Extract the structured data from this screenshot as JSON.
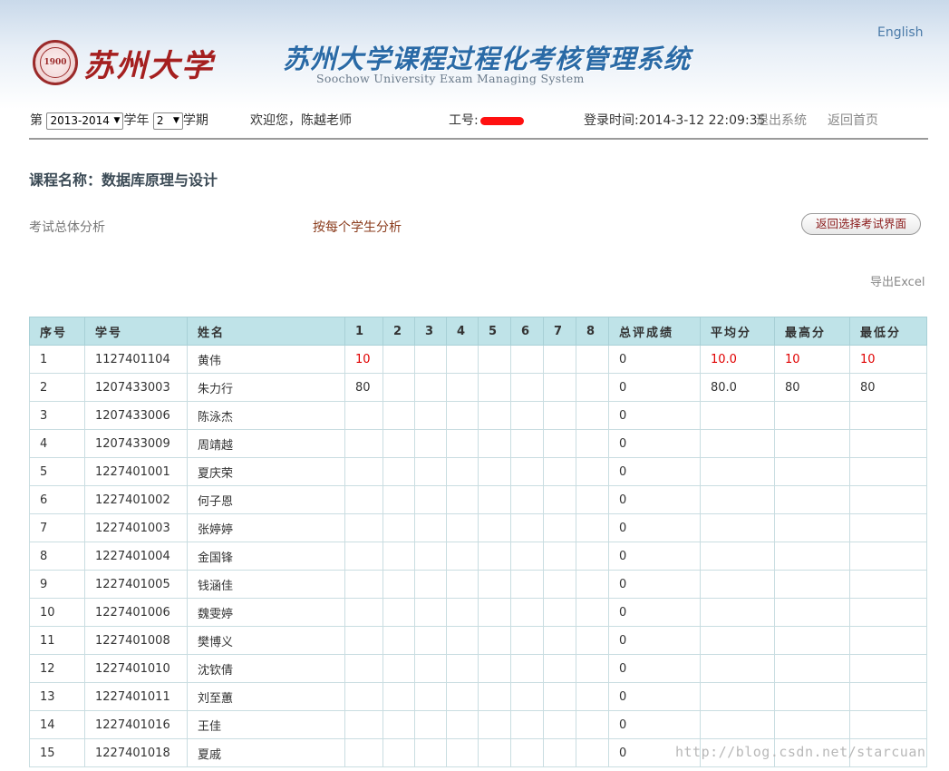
{
  "header": {
    "univ_name": "苏州大学",
    "seal_text": "1900",
    "system_title": "苏州大学课程过程化考核管理系统",
    "system_subtitle": "Soochow University Exam Managing System",
    "lang_link": "English"
  },
  "infobar": {
    "prefix": "第",
    "year_value": "2013-2014",
    "year_suffix": "学年",
    "term_value": "2",
    "term_suffix": "学期",
    "welcome": "欢迎您，陈越老师",
    "staff_id_label": "工号:",
    "login_time": "登录时间:2014-3-12 22:09:35",
    "logout": "退出系统",
    "home": "返回首页"
  },
  "course": {
    "title": "课程名称：数据库原理与设计"
  },
  "tabs": {
    "overall": "考试总体分析",
    "per_student": "按每个学生分析"
  },
  "buttons": {
    "back": "返回选择考试界面",
    "export": "导出Excel"
  },
  "table": {
    "headers": [
      "序号",
      "学号",
      "姓名",
      "1",
      "2",
      "3",
      "4",
      "5",
      "6",
      "7",
      "8",
      "总评成绩",
      "平均分",
      "最高分",
      "最低分"
    ],
    "rows": [
      {
        "no": "1",
        "id": "1127401104",
        "name": "黄伟",
        "s": [
          "10",
          "",
          "",
          "",
          "",
          "",
          "",
          ""
        ],
        "total": "0",
        "avg": "10.0",
        "max": "10",
        "min": "10"
      },
      {
        "no": "2",
        "id": "1207433003",
        "name": "朱力行",
        "s": [
          "80",
          "",
          "",
          "",
          "",
          "",
          "",
          ""
        ],
        "total": "0",
        "avg": "80.0",
        "max": "80",
        "min": "80"
      },
      {
        "no": "3",
        "id": "1207433006",
        "name": "陈泳杰",
        "s": [
          "",
          "",
          "",
          "",
          "",
          "",
          "",
          ""
        ],
        "total": "0",
        "avg": "",
        "max": "",
        "min": ""
      },
      {
        "no": "4",
        "id": "1207433009",
        "name": "周靖越",
        "s": [
          "",
          "",
          "",
          "",
          "",
          "",
          "",
          ""
        ],
        "total": "0",
        "avg": "",
        "max": "",
        "min": ""
      },
      {
        "no": "5",
        "id": "1227401001",
        "name": "夏庆荣",
        "s": [
          "",
          "",
          "",
          "",
          "",
          "",
          "",
          ""
        ],
        "total": "0",
        "avg": "",
        "max": "",
        "min": ""
      },
      {
        "no": "6",
        "id": "1227401002",
        "name": "何子恩",
        "s": [
          "",
          "",
          "",
          "",
          "",
          "",
          "",
          ""
        ],
        "total": "0",
        "avg": "",
        "max": "",
        "min": ""
      },
      {
        "no": "7",
        "id": "1227401003",
        "name": "张婷婷",
        "s": [
          "",
          "",
          "",
          "",
          "",
          "",
          "",
          ""
        ],
        "total": "0",
        "avg": "",
        "max": "",
        "min": ""
      },
      {
        "no": "8",
        "id": "1227401004",
        "name": "金国锋",
        "s": [
          "",
          "",
          "",
          "",
          "",
          "",
          "",
          ""
        ],
        "total": "0",
        "avg": "",
        "max": "",
        "min": ""
      },
      {
        "no": "9",
        "id": "1227401005",
        "name": "钱涵佳",
        "s": [
          "",
          "",
          "",
          "",
          "",
          "",
          "",
          ""
        ],
        "total": "0",
        "avg": "",
        "max": "",
        "min": ""
      },
      {
        "no": "10",
        "id": "1227401006",
        "name": "魏雯婷",
        "s": [
          "",
          "",
          "",
          "",
          "",
          "",
          "",
          ""
        ],
        "total": "0",
        "avg": "",
        "max": "",
        "min": ""
      },
      {
        "no": "11",
        "id": "1227401008",
        "name": "樊博义",
        "s": [
          "",
          "",
          "",
          "",
          "",
          "",
          "",
          ""
        ],
        "total": "0",
        "avg": "",
        "max": "",
        "min": ""
      },
      {
        "no": "12",
        "id": "1227401010",
        "name": "沈钦倩",
        "s": [
          "",
          "",
          "",
          "",
          "",
          "",
          "",
          ""
        ],
        "total": "0",
        "avg": "",
        "max": "",
        "min": ""
      },
      {
        "no": "13",
        "id": "1227401011",
        "name": "刘至蕙",
        "s": [
          "",
          "",
          "",
          "",
          "",
          "",
          "",
          ""
        ],
        "total": "0",
        "avg": "",
        "max": "",
        "min": ""
      },
      {
        "no": "14",
        "id": "1227401016",
        "name": "王佳",
        "s": [
          "",
          "",
          "",
          "",
          "",
          "",
          "",
          ""
        ],
        "total": "0",
        "avg": "",
        "max": "",
        "min": ""
      },
      {
        "no": "15",
        "id": "1227401018",
        "name": "夏戚",
        "s": [
          "",
          "",
          "",
          "",
          "",
          "",
          "",
          ""
        ],
        "total": "0",
        "avg": "",
        "max": "",
        "min": ""
      }
    ]
  },
  "colors": {
    "highlight": "#e00000",
    "header_bg": "#bfe3e8",
    "title_blue": "#2a6aa6",
    "brand_red": "#a51f1f"
  },
  "watermark": "http://blog.csdn.net/starcuan"
}
